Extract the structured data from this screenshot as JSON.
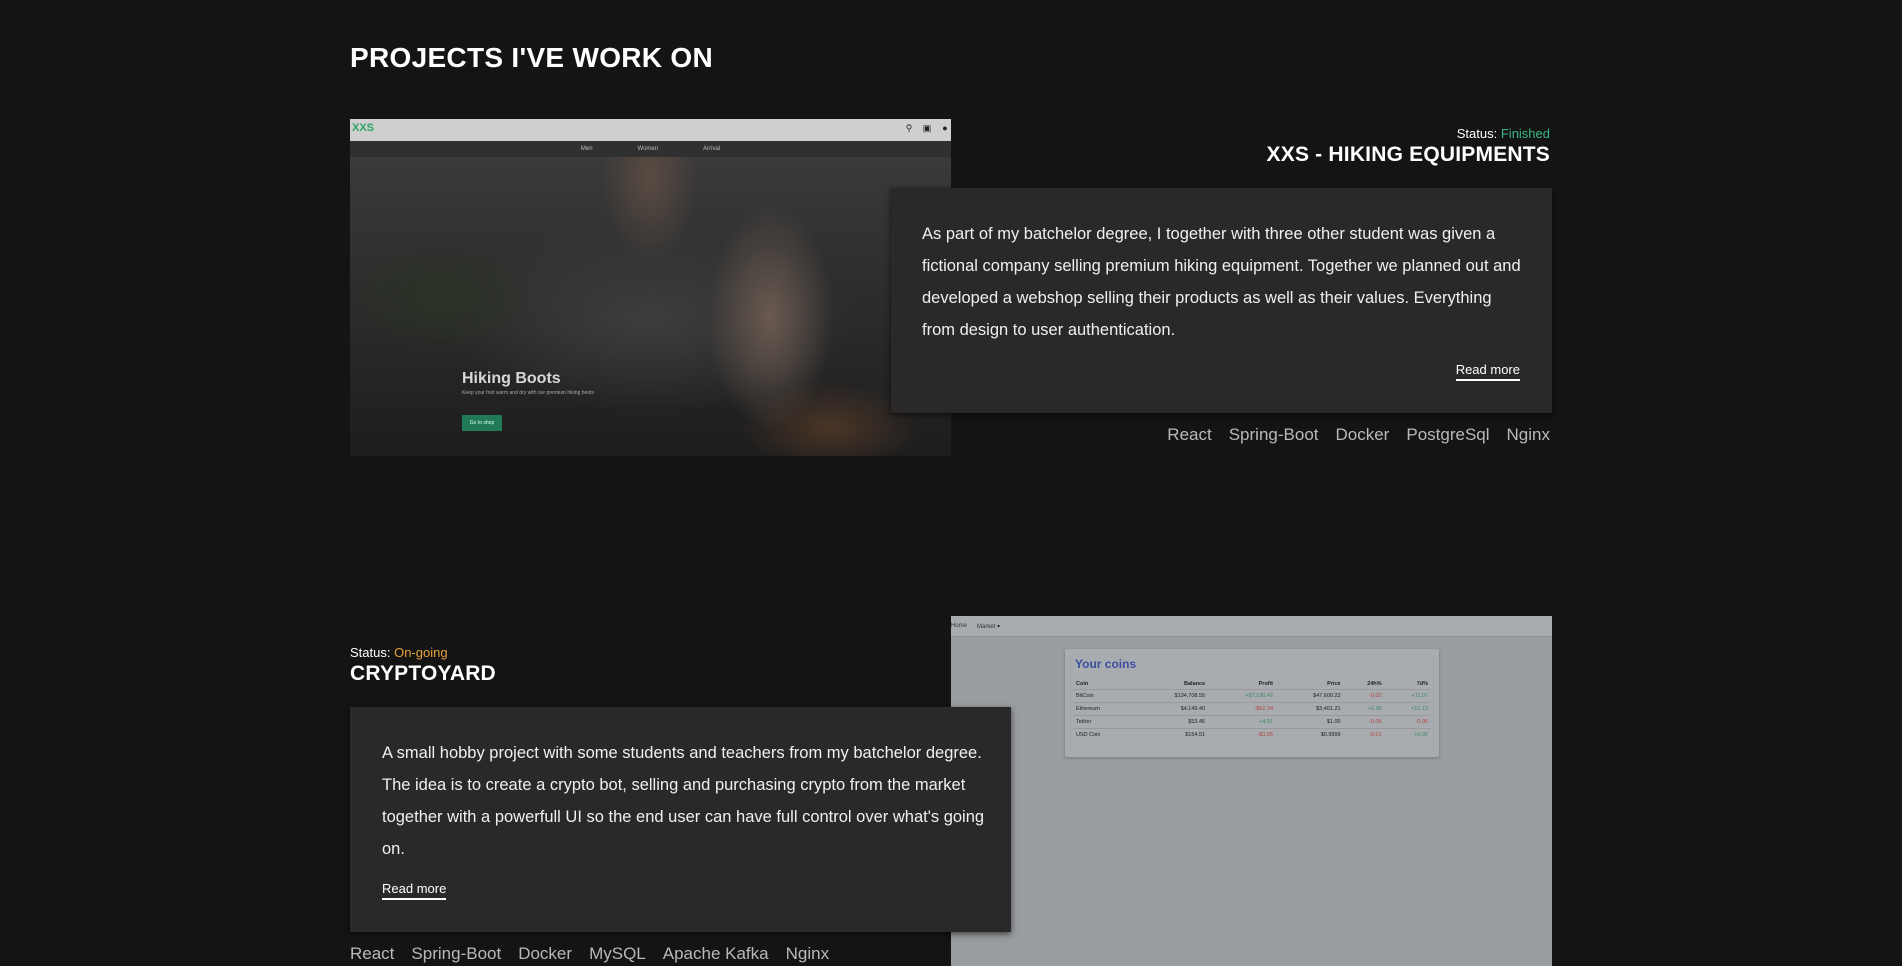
{
  "section": {
    "title": "PROJECTS I'VE WORK ON"
  },
  "projects": [
    {
      "status_label": "Status:",
      "status_value": "Finished",
      "title": "XXS - HIKING EQUIPMENTS",
      "description": "As part of my batchelor degree, I together with three other student was given a fictional company selling premium hiking equipment. Together we planned out and developed a webshop selling their products as well as their values. Everything from design to user authentication.",
      "read_more": "Read more",
      "tags": [
        "React",
        "Spring-Boot",
        "Docker",
        "PostgreSql",
        "Nginx"
      ],
      "screenshot": {
        "logo": "XXS",
        "nav": [
          "Men",
          "Women",
          "Arrival"
        ],
        "hero_title": "Hiking Boots",
        "hero_subtitle": "Keep your foot warm and dry with our premium hiking boots",
        "hero_button": "Go to shop",
        "icons": [
          "search-icon",
          "cart-icon",
          "user-icon"
        ]
      }
    },
    {
      "status_label": "Status:",
      "status_value": "On-going",
      "title": "CRYPTOYARD",
      "description": "A small hobby project with some students and teachers from my batchelor degree. The idea is to create a crypto bot, selling and purchasing crypto from the market together with a powerfull UI so the end user can have full control over what's going on.",
      "read_more": "Read more",
      "tags": [
        "React",
        "Spring-Boot",
        "Docker",
        "MySQL",
        "Apache Kafka",
        "Nginx"
      ],
      "screenshot": {
        "nav": [
          "Home",
          "Market ▾"
        ],
        "card_title": "Your coins",
        "columns": [
          "Coin",
          "Balance",
          "Profit",
          "Price",
          "24h%",
          "7d%"
        ],
        "rows": [
          [
            "BitCoin",
            "$134,708.55",
            "+$7,190.42",
            "$47,600.23",
            "-0.02",
            "+11.07"
          ],
          [
            "Ethereum",
            "$4,149.40",
            "-$62.34",
            "$3,401.21",
            "+2.36",
            "+12.13"
          ],
          [
            "Tether",
            "$53.45",
            "+4.91",
            "$1.00",
            "-0.06",
            "-0.06"
          ],
          [
            "USD Coin",
            "$154.51",
            "-$3.05",
            "$0.9999",
            "-0.01",
            "+0.02"
          ]
        ]
      }
    }
  ],
  "colors": {
    "finished": "#3cb684",
    "ongoing": "#e6a23c",
    "background": "#141414",
    "card": "#2a2829"
  }
}
